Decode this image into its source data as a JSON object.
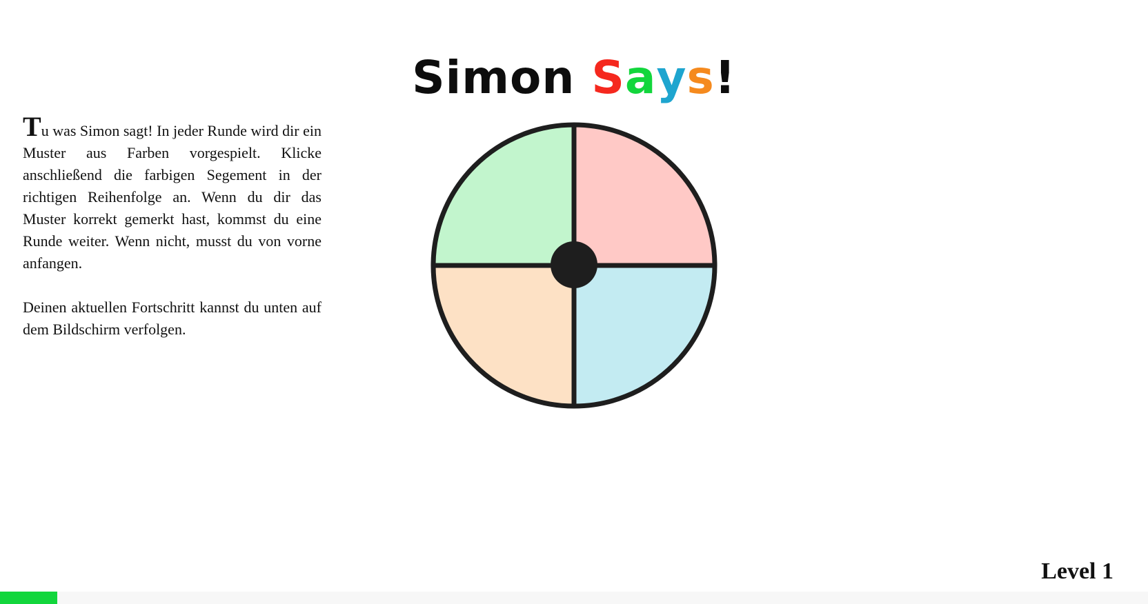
{
  "title": {
    "word1": "Simon",
    "word2_letters": [
      {
        "char": "S",
        "color": "#f5281e"
      },
      {
        "char": "a",
        "color": "#12d63c"
      },
      {
        "char": "y",
        "color": "#1ea5cf"
      },
      {
        "char": "s",
        "color": "#f58a1e"
      }
    ],
    "exclamation": "!"
  },
  "intro": {
    "dropcap": "T",
    "paragraph1_rest": "u was Simon sagt! In jeder Runde wird dir ein Muster aus Farben vorgespielt. Klicke anschließend die farbigen Segement in der richtigen Reihenfolge an. Wenn du dir das Muster korrekt gemerkt hast, kommst du eine Runde weiter. Wenn nicht, musst du von vorne anfangen.",
    "paragraph2": "Deinen aktuellen Fortschritt kannst du unten auf dem Bildschirm verfolgen."
  },
  "board": {
    "segments": {
      "top_left": {
        "color": "#c2f5cd"
      },
      "top_right": {
        "color": "#ffc9c6"
      },
      "bottom_left": {
        "color": "#fde1c5"
      },
      "bottom_right": {
        "color": "#c3ebf2"
      }
    },
    "outline_color": "#1e1e1e"
  },
  "status": {
    "level_label": "Level 1"
  },
  "progress": {
    "fraction": 0.05,
    "color": "#12d63c"
  }
}
